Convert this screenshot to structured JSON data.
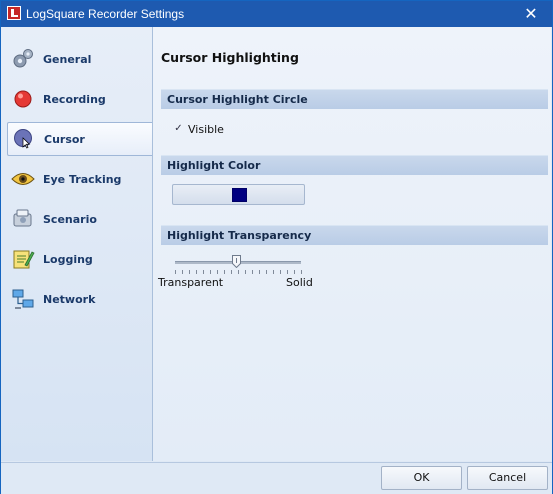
{
  "window": {
    "title": "LogSquare Recorder Settings",
    "close_glyph": "✕"
  },
  "sidebar": {
    "items": [
      {
        "label": "General",
        "icon": "gears-icon"
      },
      {
        "label": "Recording",
        "icon": "record-icon"
      },
      {
        "label": "Cursor",
        "icon": "cursor-icon",
        "active": true
      },
      {
        "label": "Eye Tracking",
        "icon": "eye-icon"
      },
      {
        "label": "Scenario",
        "icon": "scenario-icon"
      },
      {
        "label": "Logging",
        "icon": "notepad-icon"
      },
      {
        "label": "Network",
        "icon": "network-icon"
      }
    ]
  },
  "content": {
    "title": "Cursor Highlighting",
    "sections": {
      "circle": {
        "header": "Cursor Highlight Circle",
        "checkbox_label": "Visible",
        "checked": true,
        "check_glyph": "✓"
      },
      "color": {
        "header": "Highlight Color",
        "swatch_color": "#000080"
      },
      "transparency": {
        "header": "Highlight Transparency",
        "min_label": "Transparent",
        "max_label": "Solid",
        "value_fraction": 0.5
      }
    }
  },
  "footer": {
    "ok_label": "OK",
    "cancel_label": "Cancel"
  },
  "colors": {
    "titlebar": "#1e5ab0",
    "accent": "#1b3a6a"
  }
}
